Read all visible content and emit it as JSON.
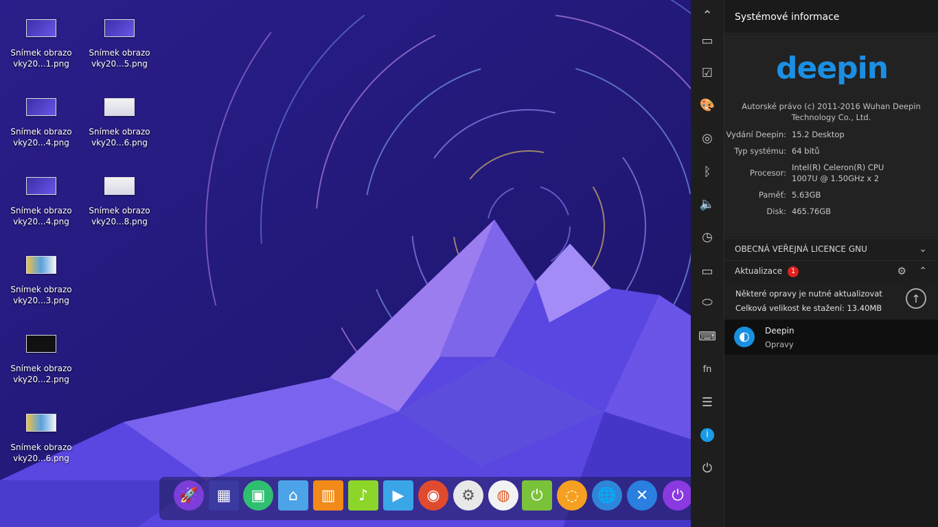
{
  "desktop": {
    "files": [
      {
        "line1": "Snímek obrazo",
        "line2": "vky20...1.png"
      },
      {
        "line1": "Snímek obrazo",
        "line2": "vky20...5.png"
      },
      {
        "line1": "Snímek obrazo",
        "line2": "vky20...4.png"
      },
      {
        "line1": "Snímek obrazo",
        "line2": "vky20...6.png"
      },
      {
        "line1": "Snímek obrazo",
        "line2": "vky20...4.png"
      },
      {
        "line1": "Snímek obrazo",
        "line2": "vky20...8.png"
      },
      {
        "line1": "Snímek obrazo",
        "line2": "vky20...3.png"
      },
      {
        "line1": "Snímek obrazo",
        "line2": "vky20...2.png"
      },
      {
        "line1": "Snímek obrazo",
        "line2": "vky20...6.png"
      }
    ]
  },
  "dock": {
    "apps": [
      "launcher-icon",
      "multitasking-icon",
      "store-icon",
      "file-manager-icon",
      "app-store-icon",
      "music-icon",
      "video-icon",
      "chrome-icon",
      "settings-icon",
      "screenshot-icon",
      "power-manager-icon",
      "update-icon",
      "browser-icon",
      "network-icon",
      "shutdown-icon"
    ]
  },
  "sidebar": {
    "icons": [
      "chevron-up-icon",
      "display-icon",
      "default-apps-icon",
      "personalization-icon",
      "network-icon",
      "bluetooth-icon",
      "sound-icon",
      "time-icon",
      "power-icon",
      "mouse-icon",
      "keyboard-icon",
      "fn-key-icon",
      "update-settings-icon",
      "info-icon",
      "shutdown-icon"
    ]
  },
  "panel": {
    "title": "Systémové informace",
    "logo_text": "deepin",
    "copyright": "Autorské právo (c) 2011-2016 Wuhan Deepin Technology Co., Ltd.",
    "rows": [
      {
        "key": "Vydání Deepin:",
        "value": "15.2 Desktop"
      },
      {
        "key": "Typ systému:",
        "value": "64 bitů"
      },
      {
        "key": "Procesor:",
        "value": "Intel(R) Celeron(R) CPU 1007U @ 1.50GHz x 2"
      },
      {
        "key": "Paměť:",
        "value": "5.63GB"
      },
      {
        "key": "Disk:",
        "value": "465.76GB"
      }
    ],
    "license_label": "OBECNÁ VEŘEJNÁ LICENCE GNU",
    "updates_label": "Aktualizace",
    "updates_count": "1",
    "update_message": "Některé opravy je nutné aktualizovat",
    "update_size": "Celková velikost ke stažení: 13.40MB",
    "update_item_name": "Deepin",
    "update_item_desc": "Opravy"
  }
}
